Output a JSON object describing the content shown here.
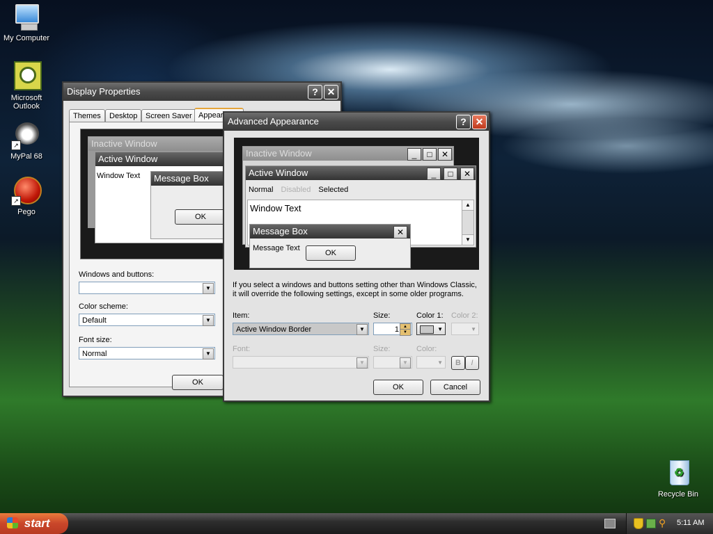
{
  "desktop": {
    "icons": [
      {
        "label": "My Computer"
      },
      {
        "label": "Microsoft Outlook"
      },
      {
        "label": "MyPal 68"
      },
      {
        "label": "Pego"
      },
      {
        "label": "Recycle Bin"
      }
    ]
  },
  "display_properties": {
    "title": "Display Properties",
    "tabs": [
      "Themes",
      "Desktop",
      "Screen Saver",
      "Appearance"
    ],
    "preview": {
      "inactive_title": "Inactive Window",
      "active_title": "Active Window",
      "window_text": "Window Text",
      "message_box_title": "Message Box",
      "ok": "OK"
    },
    "windows_buttons_label": "Windows and buttons:",
    "windows_buttons_value": "",
    "color_scheme_label": "Color scheme:",
    "color_scheme_value": "Default",
    "font_size_label": "Font size:",
    "font_size_value": "Normal",
    "ok_label": "OK"
  },
  "advanced": {
    "title": "Advanced Appearance",
    "preview": {
      "inactive_title": "Inactive Window",
      "active_title": "Active Window",
      "menu_normal": "Normal",
      "menu_disabled": "Disabled",
      "menu_selected": "Selected",
      "window_text": "Window Text",
      "message_box_title": "Message Box",
      "message_text": "Message Text",
      "ok": "OK"
    },
    "info_text": "If you select a windows and buttons setting other than Windows Classic, it will override the following settings, except in some older programs.",
    "item_label": "Item:",
    "item_value": "Active Window Border",
    "size_label": "Size:",
    "size_value": "1",
    "color1_label": "Color 1:",
    "color2_label": "Color 2:",
    "font_label": "Font:",
    "font_size_label": "Size:",
    "font_color_label": "Color:",
    "bold_label": "B",
    "italic_label": "I",
    "ok_label": "OK",
    "cancel_label": "Cancel"
  },
  "taskbar": {
    "start_label": "start",
    "clock": "5:11 AM"
  },
  "colors": {
    "start_orange": "#c9462a",
    "title_dark": "#3a3a3a",
    "selected_tab_accent": "#e5a53a",
    "close_red": "#c0391c"
  }
}
